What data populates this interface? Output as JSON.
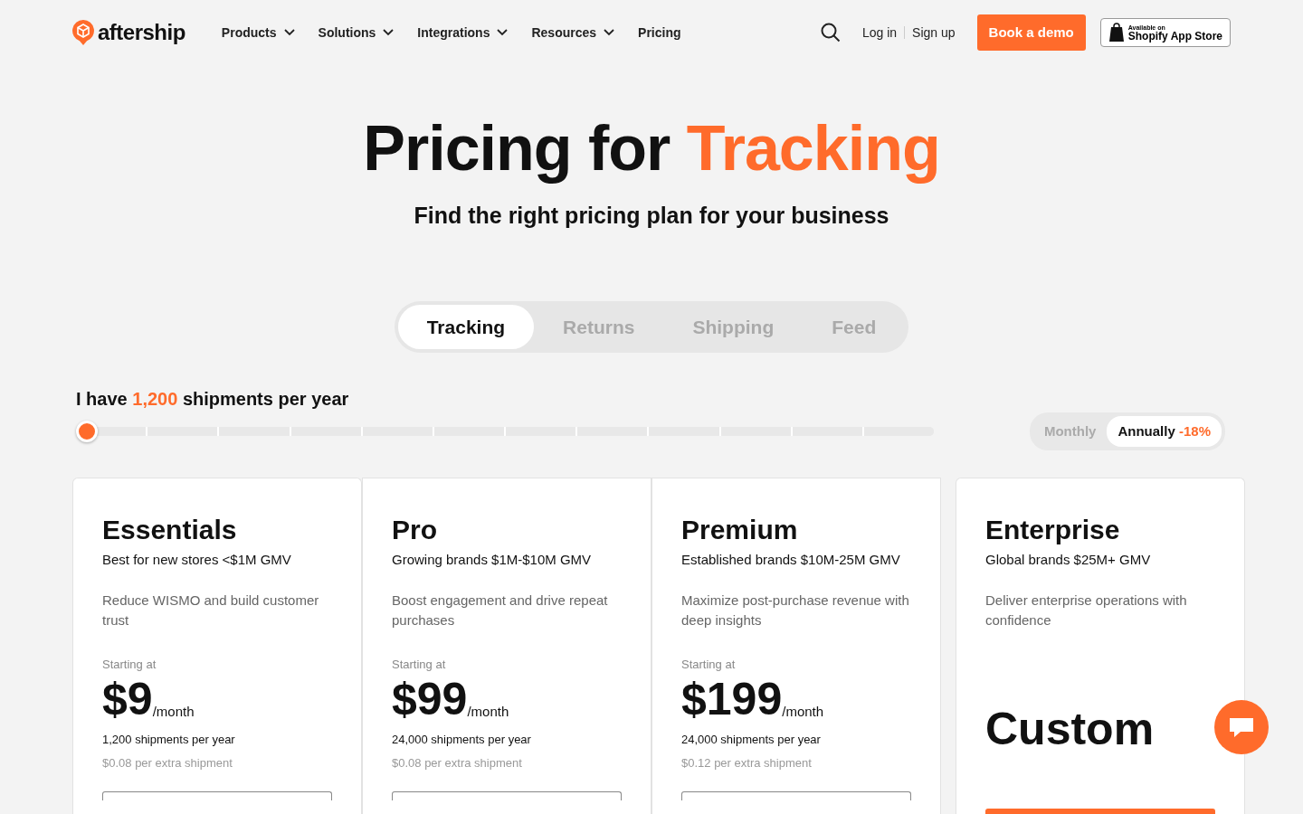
{
  "header": {
    "logo": "aftership",
    "nav": [
      {
        "label": "Products",
        "dropdown": true
      },
      {
        "label": "Solutions",
        "dropdown": true
      },
      {
        "label": "Integrations",
        "dropdown": true
      },
      {
        "label": "Resources",
        "dropdown": true
      },
      {
        "label": "Pricing",
        "dropdown": false
      }
    ],
    "login": "Log in",
    "signup": "Sign up",
    "demo": "Book a demo",
    "store_small": "Available on",
    "store": "Shopify App Store"
  },
  "hero": {
    "title_prefix": "Pricing for",
    "title_highlight": "Tracking",
    "subtitle": "Find the right pricing plan for your business"
  },
  "tabs": [
    {
      "label": "Tracking",
      "selected": true
    },
    {
      "label": "Returns",
      "selected": false
    },
    {
      "label": "Shipping",
      "selected": false
    },
    {
      "label": "Feed",
      "selected": false
    }
  ],
  "volume": {
    "prefix": "I have",
    "value": "1,200",
    "suffix": "shipments per year",
    "level": 0
  },
  "billing": [
    {
      "label": "Monthly",
      "selected": false
    },
    {
      "label": "Annually",
      "selected": true,
      "discount": "-18%"
    }
  ],
  "plans": [
    {
      "kind": "priced",
      "name": "Essentials",
      "audience": "Best for new stores <$1M GMV",
      "description": "Reduce WISMO and build customer trust",
      "starting": "Starting at",
      "price": "$9",
      "period": "/month",
      "included": "1,200 shipments per year",
      "extra": "$0.08 per extra shipment"
    },
    {
      "kind": "priced",
      "name": "Pro",
      "audience": "Growing brands $1M-$10M GMV",
      "description": "Boost engagement and drive repeat purchases",
      "starting": "Starting at",
      "price": "$99",
      "period": "/month",
      "included": "24,000 shipments per year",
      "extra": "$0.08 per extra shipment"
    },
    {
      "kind": "priced",
      "name": "Premium",
      "audience": "Established brands $10M-25M GMV",
      "description": "Maximize post-purchase revenue with deep insights",
      "starting": "Starting at",
      "price": "$199",
      "period": "/month",
      "included": "24,000 shipments per year",
      "extra": "$0.12 per extra shipment"
    },
    {
      "kind": "custom",
      "name": "Enterprise",
      "audience": "Global brands $25M+ GMV",
      "description": "Deliver enterprise operations with confidence",
      "price": "Custom"
    }
  ]
}
